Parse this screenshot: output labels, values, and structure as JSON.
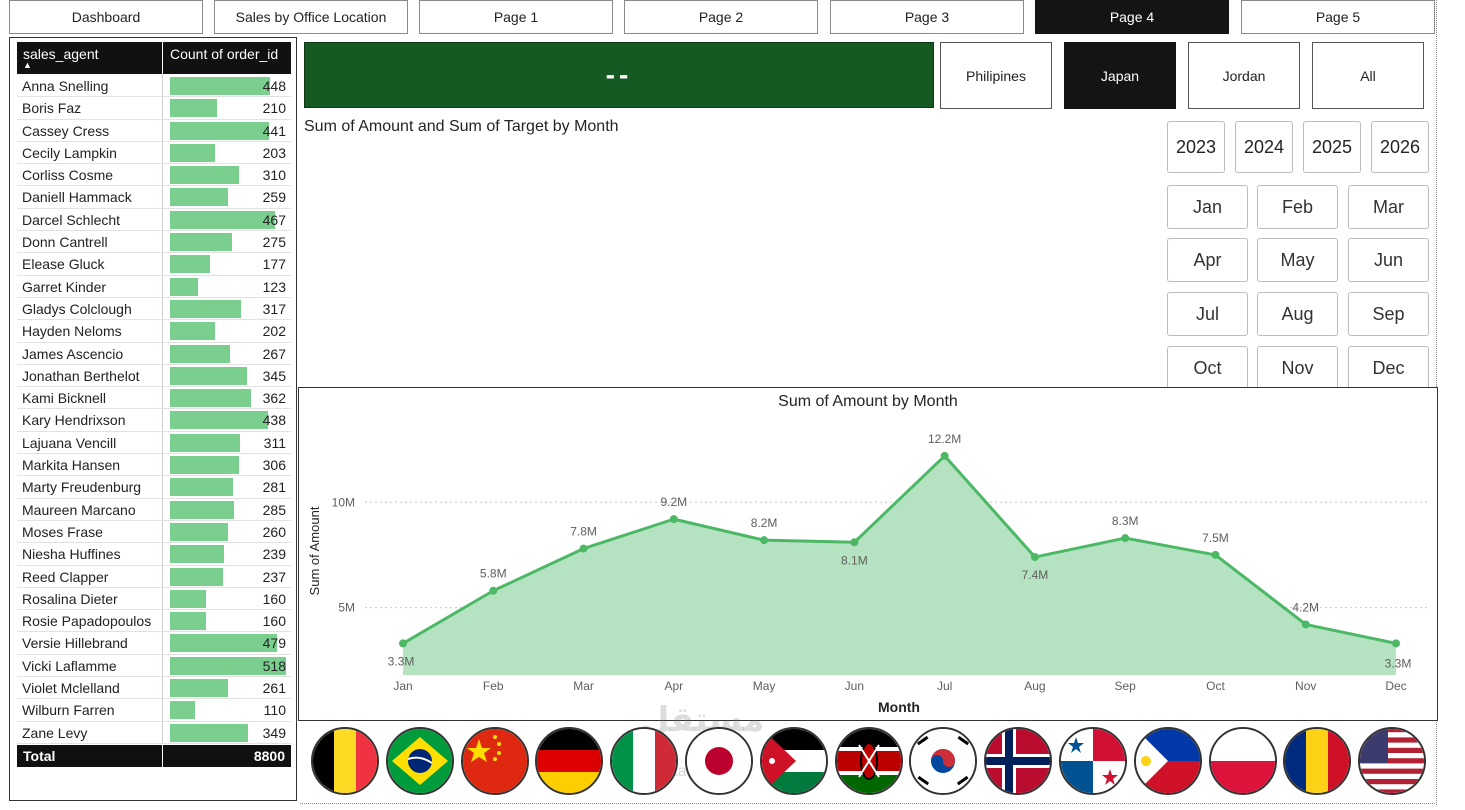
{
  "nav": {
    "tabs": [
      {
        "label": "Dashboard",
        "active": false
      },
      {
        "label": "Sales by Office Location",
        "active": false
      },
      {
        "label": "Page 1",
        "active": false
      },
      {
        "label": "Page 2",
        "active": false
      },
      {
        "label": "Page 3",
        "active": false
      },
      {
        "label": "Page 4",
        "active": true
      },
      {
        "label": "Page 5",
        "active": false
      }
    ]
  },
  "table": {
    "col1": "sales_agent",
    "col2": "Count of order_id",
    "sort_indicator": "▲",
    "bar_color": "#7bcf8e",
    "rows": [
      {
        "name": "Anna Snelling",
        "value": 448
      },
      {
        "name": "Boris Faz",
        "value": 210
      },
      {
        "name": "Cassey Cress",
        "value": 441
      },
      {
        "name": "Cecily Lampkin",
        "value": 203
      },
      {
        "name": "Corliss Cosme",
        "value": 310
      },
      {
        "name": "Daniell Hammack",
        "value": 259
      },
      {
        "name": "Darcel Schlecht",
        "value": 467
      },
      {
        "name": "Donn Cantrell",
        "value": 275
      },
      {
        "name": "Elease Gluck",
        "value": 177
      },
      {
        "name": "Garret Kinder",
        "value": 123
      },
      {
        "name": "Gladys Colclough",
        "value": 317
      },
      {
        "name": "Hayden Neloms",
        "value": 202
      },
      {
        "name": "James Ascencio",
        "value": 267
      },
      {
        "name": "Jonathan Berthelot",
        "value": 345
      },
      {
        "name": "Kami Bicknell",
        "value": 362
      },
      {
        "name": "Kary Hendrixson",
        "value": 438
      },
      {
        "name": "Lajuana Vencill",
        "value": 311
      },
      {
        "name": "Markita Hansen",
        "value": 306
      },
      {
        "name": "Marty Freudenburg",
        "value": 281
      },
      {
        "name": "Maureen Marcano",
        "value": 285
      },
      {
        "name": "Moses Frase",
        "value": 260
      },
      {
        "name": "Niesha Huffines",
        "value": 239
      },
      {
        "name": "Reed Clapper",
        "value": 237
      },
      {
        "name": "Rosalina Dieter",
        "value": 160
      },
      {
        "name": "Rosie Papadopoulos",
        "value": 160
      },
      {
        "name": "Versie Hillebrand",
        "value": 479
      },
      {
        "name": "Vicki Laflamme",
        "value": 518
      },
      {
        "name": "Violet Mclelland",
        "value": 261
      },
      {
        "name": "Wilburn Farren",
        "value": 110
      },
      {
        "name": "Zane Levy",
        "value": 349
      }
    ],
    "total_label": "Total",
    "total_value": "8800"
  },
  "kpi": {
    "value": "--",
    "color": "#145a22"
  },
  "country_filter": [
    {
      "label": "Philipines",
      "active": false
    },
    {
      "label": "Japan",
      "active": true
    },
    {
      "label": "Jordan",
      "active": false
    },
    {
      "label": "All",
      "active": false
    }
  ],
  "chart1": {
    "title": "Sum of Amount and Sum of Target by Month"
  },
  "year_filter": [
    "2023",
    "2024",
    "2025",
    "2026"
  ],
  "month_filter": [
    "Jan",
    "Feb",
    "Mar",
    "Apr",
    "May",
    "Jun",
    "Jul",
    "Aug",
    "Sep",
    "Oct",
    "Nov",
    "Dec"
  ],
  "chart_data": {
    "type": "area",
    "title": "Sum of Amount by Month",
    "xlabel": "Month",
    "ylabel": "Sum of Amount",
    "categories": [
      "Jan",
      "Feb",
      "Mar",
      "Apr",
      "May",
      "Jun",
      "Jul",
      "Aug",
      "Sep",
      "Oct",
      "Nov",
      "Dec"
    ],
    "values": [
      3.3,
      5.8,
      7.8,
      9.2,
      8.2,
      8.1,
      12.2,
      7.4,
      8.3,
      7.5,
      4.2,
      3.3
    ],
    "data_labels": [
      "3.3M",
      "5.8M",
      "7.8M",
      "9.2M",
      "8.2M",
      "8.1M",
      "12.2M",
      "7.4M",
      "8.3M",
      "7.5M",
      "4.2M",
      "3.3M"
    ],
    "yticks": [
      {
        "value": 5,
        "label": "5M"
      },
      {
        "value": 10,
        "label": "10M"
      }
    ],
    "ylim": [
      1.8,
      14
    ],
    "grid": true,
    "line_color": "#4cb866",
    "fill_color": "#b5e3c1"
  },
  "flags": [
    "belgium-flag",
    "brazil-flag",
    "china-flag",
    "germany-flag",
    "italy-flag",
    "japan-flag",
    "jordan-flag",
    "kenya-flag",
    "south-korea-flag",
    "norway-flag",
    "panama-flag",
    "philippines-flag",
    "poland-flag",
    "romania-flag",
    "usa-flag"
  ]
}
